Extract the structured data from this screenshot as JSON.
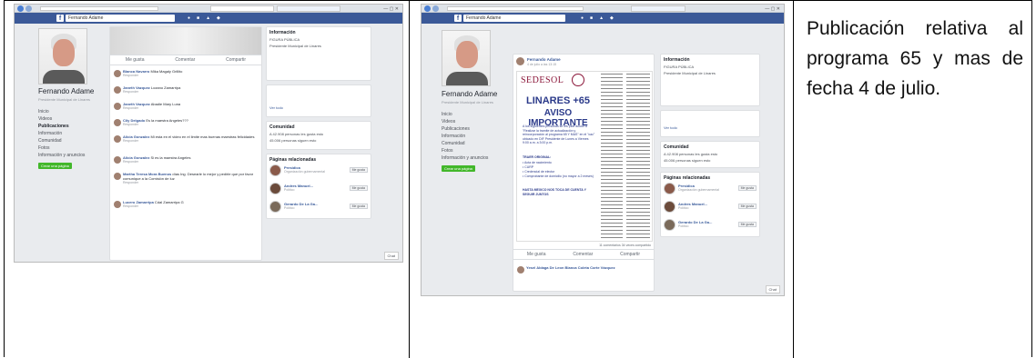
{
  "caption": "Publicación relativa al programa 65 y mas de fecha 4 de julio.",
  "shot1": {
    "fb_search": "Fernando Adame",
    "profile_name": "Fernando Adame",
    "profile_sub": "Presidente Municipal de Linares",
    "nav_items": [
      "Inicio",
      "Videos",
      "Publicaciones",
      "Información",
      "Comunidad",
      "Fotos",
      "Información y anuncios"
    ],
    "create_page": "Crear una página",
    "post_actions": [
      "Me gusta",
      "Comentar",
      "Compartir"
    ],
    "comments": [
      {
        "name": "Blanca Navarro",
        "text": "Mika Magaly Grillito"
      },
      {
        "name": "Janeth Vazquez",
        "text": "Lozano Zamarripa"
      },
      {
        "name": "Janeth Vazquez",
        "text": "Abadie Mary Luna"
      },
      {
        "name": "Cily Delgado",
        "text": "Es la maestra Angeles???"
      },
      {
        "name": "Alicia Gonzalez",
        "text": "Mi esta en el video en el limite mas buenas maestras felicidades"
      },
      {
        "name": "Alicia Gonzalez",
        "text": "Si es la maestra Angeles"
      },
      {
        "name": "Martha Teresa Mora Buenos",
        "text": "días Ing. Desearle lo mejor y pedirle que por favor comunique a la Comisión de luz"
      },
      {
        "name": "Lucero Zamarripa",
        "text": "Cdal Zamarripa G"
      }
    ],
    "right_info_title": "Información",
    "right_info_line1": "FIGURA PÚBLICA",
    "right_info_line2": "Presidente Municipal de Linares",
    "right_see_all": "Ver todo",
    "community_title": "Comunidad",
    "community_lines": [
      "A 42.908 personas les gusta esto",
      "45.006 personas siguen esto"
    ],
    "related_title": "Páginas relacionadas",
    "related_pages": [
      {
        "name": "Presidica",
        "sub": "Organización gubernamental"
      },
      {
        "name": "Andres Manuel...",
        "sub": "Político"
      },
      {
        "name": "Gerardo De La Ga...",
        "sub": "Político"
      }
    ],
    "like_label": "Me gusta",
    "chat_label": "Chat",
    "reply_link": "Responder"
  },
  "shot2": {
    "fb_search": "Fernando Adame",
    "profile_name": "Fernando Adame",
    "profile_sub": "Presidente Municipal de Linares",
    "nav_items": [
      "Inicio",
      "Videos",
      "Publicaciones",
      "Información",
      "Comunidad",
      "Fotos",
      "Información y anuncios"
    ],
    "create_page": "Crear una página",
    "post_author": "Fernando Adame",
    "post_date": "4 de julio a las 13:15",
    "flyer_brand": "SEDESOL",
    "flyer_title1": "LINARES +65",
    "flyer_title2": "AVISO IMPORTANTE",
    "flyer_body": "A los siguientes personas se les pide acudir a \"Realizar la tramite de actualización y reincorporación al programa 65 Y MAS\" en el \"cac\" ubicado en DIF Presidente de Lunes a Viernes 9:00 a.m. a 3:00 p.m.",
    "flyer_req_title": "TRAER ORIGINAL:",
    "flyer_reqs": [
      "Acta de nacimiento",
      "CURP",
      "Credencial de elector",
      "Comprobante de domicilio (no mayor a 2 meses)"
    ],
    "flyer_footer": "HASTA MEXICO NOS TOCA DE CUENTA Y SEGUIR JUNTOS",
    "post_actions": [
      "Me gusta",
      "Comentar",
      "Compartir"
    ],
    "reactions": "11 comentarios  34 veces compartido",
    "comment_name": "Yesel Aldaga De Leon Blanca Coleta Corte Vázquez",
    "right_info_title": "Información",
    "right_info_line1": "FIGURA PÚBLICA",
    "right_info_line2": "Presidente Municipal de Linares",
    "right_see_all": "Ver todo",
    "community_title": "Comunidad",
    "community_lines": [
      "A 42.908 personas les gusta esto",
      "45.006 personas siguen esto"
    ],
    "related_title": "Páginas relacionadas",
    "related_pages": [
      {
        "name": "Presidica",
        "sub": "Organización gubernamental"
      },
      {
        "name": "Andres Manuel...",
        "sub": "Político"
      },
      {
        "name": "Gerardo De La Ga...",
        "sub": "Político"
      }
    ],
    "like_label": "Me gusta",
    "chat_label": "Chat"
  }
}
